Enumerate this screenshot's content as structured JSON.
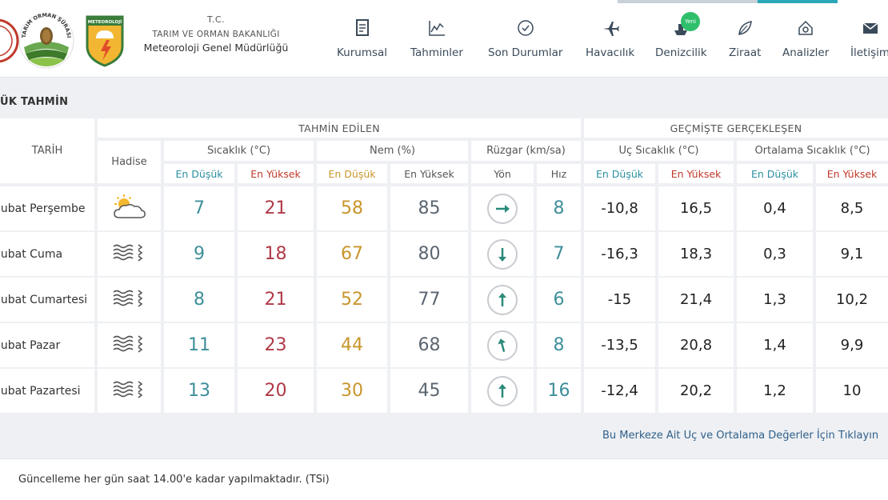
{
  "ministry": {
    "tc": "T.C.",
    "bakanlik": "TARIM VE ORMAN BAKANLIĞI",
    "mgm": "Meteoroloji Genel Müdürlüğü"
  },
  "logos": {
    "second_text": "TARIM ORMAN ŞÛRASI",
    "third_text": "METEOROLOJİ"
  },
  "nav": {
    "items": [
      {
        "label": "Kurumsal",
        "icon": "document-icon"
      },
      {
        "label": "Tahminler",
        "icon": "chart-icon"
      },
      {
        "label": "Son Durumlar",
        "icon": "clock-icon"
      },
      {
        "label": "Havacılık",
        "icon": "plane-icon"
      },
      {
        "label": "Denizcilik",
        "icon": "ship-icon"
      },
      {
        "label": "Ziraat",
        "icon": "leaf-icon"
      },
      {
        "label": "Analizler",
        "icon": "analysis-icon"
      },
      {
        "label": "İletişim",
        "icon": "mail-icon"
      }
    ],
    "new_badge": "Yeni"
  },
  "section_title": "ÜK TAHMİN",
  "table": {
    "group_predicted": "TAHMİN EDİLEN",
    "group_past": "GEÇMİŞTE GERÇEKLEŞEN",
    "col_date": "TARİH",
    "col_event": "Hadise",
    "col_temp": "Sıcaklık (°C)",
    "col_humidity": "Nem (%)",
    "col_wind": "Rüzgar (km/sa)",
    "col_extreme": "Uç Sıcaklık (°C)",
    "col_average": "Ortalama Sıcaklık (°C)",
    "sub_low": "En Düşük",
    "sub_high": "En Yüksek",
    "sub_dir": "Yön",
    "sub_speed": "Hız",
    "rows": [
      {
        "date": "Şubat Perşembe",
        "event": "partly-cloudy-icon",
        "t_low": "7",
        "t_high": "21",
        "h_low": "58",
        "h_high": "85",
        "wind_dir": "east",
        "wind_angle": 90,
        "wind_speed": "8",
        "ext_low": "-10,8",
        "ext_high": "16,5",
        "avg_low": "0,4",
        "avg_high": "8,5"
      },
      {
        "date": "Şubat Cuma",
        "event": "fog-icon",
        "t_low": "9",
        "t_high": "18",
        "h_low": "67",
        "h_high": "80",
        "wind_dir": "south",
        "wind_angle": 180,
        "wind_speed": "7",
        "ext_low": "-16,3",
        "ext_high": "18,3",
        "avg_low": "0,3",
        "avg_high": "9,1"
      },
      {
        "date": "Şubat Cumartesi",
        "event": "fog-icon",
        "t_low": "8",
        "t_high": "21",
        "h_low": "52",
        "h_high": "77",
        "wind_dir": "north",
        "wind_angle": 0,
        "wind_speed": "6",
        "ext_low": "-15",
        "ext_high": "21,4",
        "avg_low": "1,3",
        "avg_high": "10,2"
      },
      {
        "date": "Şubat Pazar",
        "event": "fog-icon",
        "t_low": "11",
        "t_high": "23",
        "h_low": "44",
        "h_high": "68",
        "wind_dir": "north-northwest",
        "wind_angle": 345,
        "wind_speed": "8",
        "ext_low": "-13,5",
        "ext_high": "20,8",
        "avg_low": "1,4",
        "avg_high": "9,9"
      },
      {
        "date": "Şubat Pazartesi",
        "event": "fog-icon",
        "t_low": "13",
        "t_high": "20",
        "h_low": "30",
        "h_high": "45",
        "wind_dir": "north",
        "wind_angle": 0,
        "wind_speed": "16",
        "ext_low": "-12,4",
        "ext_high": "20,2",
        "avg_low": "1,2",
        "avg_high": "10"
      }
    ]
  },
  "link_text": "Bu Merkeze Ait Uç ve Ortalama Değerler İçin Tıklayın",
  "footer_text": "Güncelleme her gün saat 14.00'e kadar yapılmaktadır. (TSi)",
  "colors": {
    "accent": "#2aa8b8",
    "low": "#3e8f9a",
    "high": "#b03a48",
    "humidity_low": "#c8962c"
  }
}
